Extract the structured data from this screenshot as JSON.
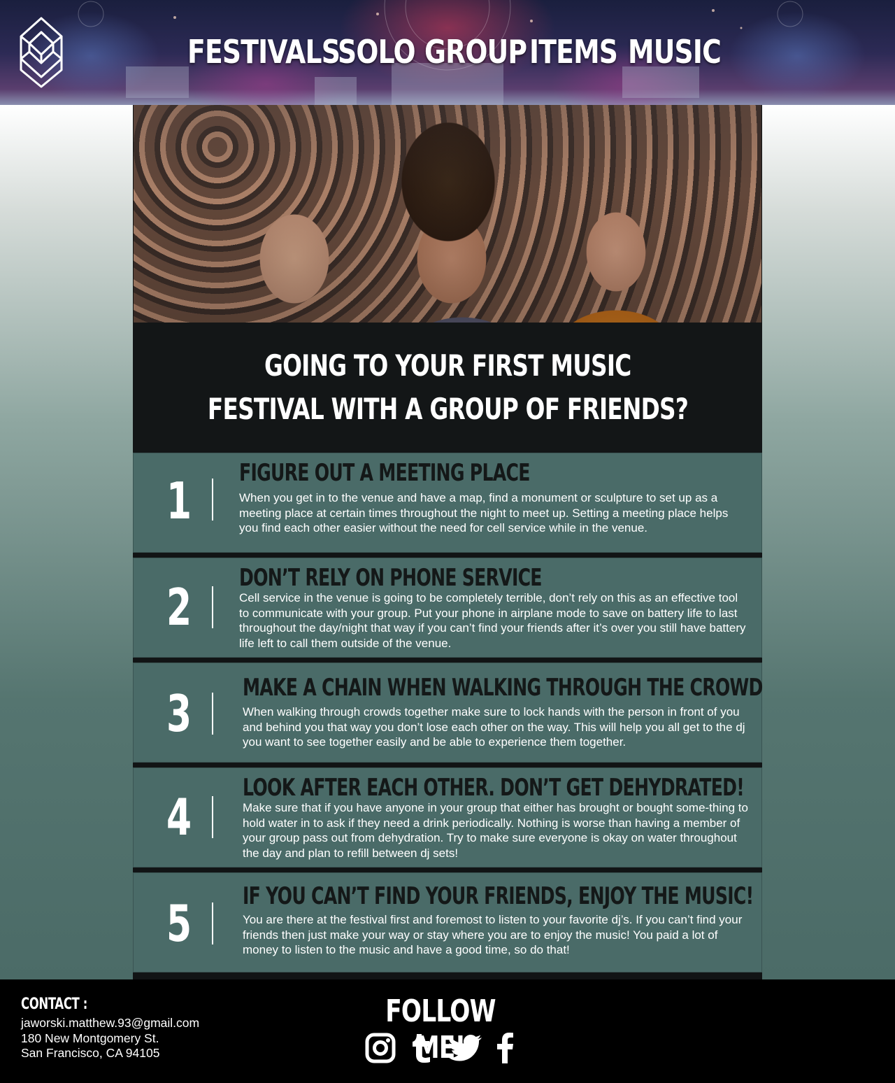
{
  "header": {
    "logo_icon": "mw-monogram-logo",
    "nav": [
      {
        "label": "FESTIVALS"
      },
      {
        "label": "SOLO"
      },
      {
        "label": "GROUP"
      },
      {
        "label": "ITEMS"
      },
      {
        "label": "MUSIC"
      }
    ]
  },
  "hero": {
    "image": "festival-crowd-photo"
  },
  "intro": {
    "line1": "GOING TO YOUR FIRST MUSIC",
    "line2": "FESTIVAL WITH A GROUP OF FRIENDS?"
  },
  "tips": [
    {
      "number": "1",
      "title": "FIGURE OUT A MEETING PLACE",
      "body": "When you get in to the venue and have a map, find a monument or sculpture to set up as a meeting place at certain times throughout the night to meet up. Setting a meeting place helps you find each other easier without the need for cell service while in the venue."
    },
    {
      "number": "2",
      "title": "DON’T RELY ON PHONE SERVICE",
      "body": "Cell service in the venue is going to be completely terrible, don’t rely on this as an effective tool to communicate with your group. Put your phone in airplane mode to save on battery life to last throughout the day/night that way if you can’t find your friends after it’s over you still have battery life left to call them outside of the venue."
    },
    {
      "number": "3",
      "title": "MAKE A CHAIN WHEN WALKING THROUGH THE CROWD",
      "body": "When walking through crowds together make sure to lock hands with the person in front of you and behind you that way you don’t lose each other on the way. This will help you all get to the dj you want to see together easily and be able to experience them together."
    },
    {
      "number": "4",
      "title": "LOOK AFTER EACH OTHER. DON’T GET DEHYDRATED!",
      "body": "Make sure that if you have anyone in your group that either has brought or bought some-thing to hold water in to ask if they need a drink periodically. Nothing is worse than having a member of your group pass out from dehydration. Try to make sure everyone is okay on water throughout the day and plan to refill between dj sets!"
    },
    {
      "number": "5",
      "title": "IF YOU CAN’T FIND YOUR FRIENDS, ENJOY THE MUSIC!",
      "body": "You are there at the festival first and foremost to listen to your favorite dj’s. If you can’t find your friends then just make your way or stay where you are to enjoy the music! You paid a lot of money to listen to the music and have a good time, so do that!"
    }
  ],
  "footer": {
    "contact_heading": "CONTACT :",
    "email": "jaworski.matthew.93@gmail.com",
    "address_line1": "180 New Montgomery St.",
    "address_line2": "San Francisco, CA 94105",
    "follow_heading": "FOLLOW ME!",
    "social": [
      {
        "icon": "instagram-icon"
      },
      {
        "icon": "tumblr-icon"
      },
      {
        "icon": "twitter-icon"
      },
      {
        "icon": "facebook-icon"
      }
    ]
  },
  "colors": {
    "tip_background": "#4a6b68",
    "intro_background": "#131617",
    "footer_background": "#000000",
    "tip_title": "#141818"
  }
}
